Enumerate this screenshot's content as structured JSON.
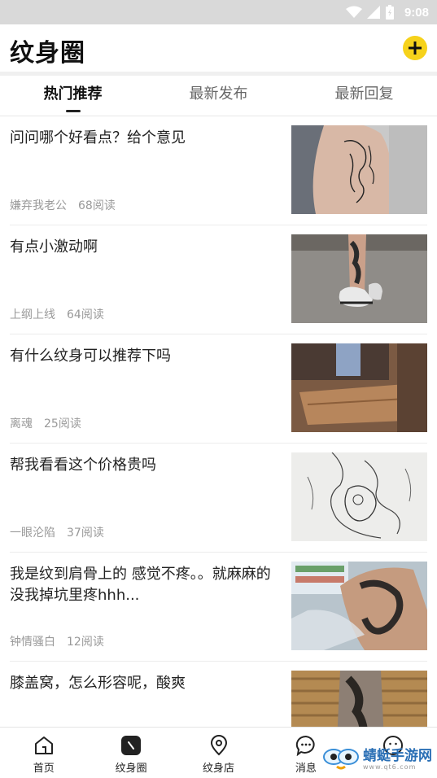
{
  "status_bar": {
    "time": "9:08"
  },
  "header": {
    "title": "纹身圈",
    "add_icon": "plus-icon"
  },
  "tabs": [
    {
      "label": "热门推荐",
      "active": true
    },
    {
      "label": "最新发布",
      "active": false
    },
    {
      "label": "最新回复",
      "active": false
    }
  ],
  "posts": [
    {
      "title": "问问哪个好看点？给个意见",
      "author": "嫌弃我老公",
      "reads": "68阅读"
    },
    {
      "title": "有点小激动啊",
      "author": "上纲上线",
      "reads": "64阅读"
    },
    {
      "title": "有什么纹身可以推荐下吗",
      "author": "离魂",
      "reads": "25阅读"
    },
    {
      "title": "帮我看看这个价格贵吗",
      "author": "一眼沦陷",
      "reads": "37阅读"
    },
    {
      "title": "我是纹到肩骨上的 感觉不疼。。就麻麻的 没我掉坑里疼hhh...",
      "author": "钟情骚白",
      "reads": "12阅读"
    },
    {
      "title": "膝盖窝，怎么形容呢，酸爽",
      "author": "",
      "reads": ""
    }
  ],
  "bottom_nav": [
    {
      "label": "首页",
      "icon": "home-icon"
    },
    {
      "label": "纹身圈",
      "icon": "circle-icon",
      "active": true
    },
    {
      "label": "纹身店",
      "icon": "location-icon"
    },
    {
      "label": "消息",
      "icon": "message-icon"
    },
    {
      "label": "",
      "icon": "profile-icon"
    }
  ],
  "watermark": {
    "text": "蜻蜓手游网",
    "sub": "www.qt6.com"
  },
  "colors": {
    "accent": "#f6d21b",
    "status_bar": "#d9d9d9"
  }
}
